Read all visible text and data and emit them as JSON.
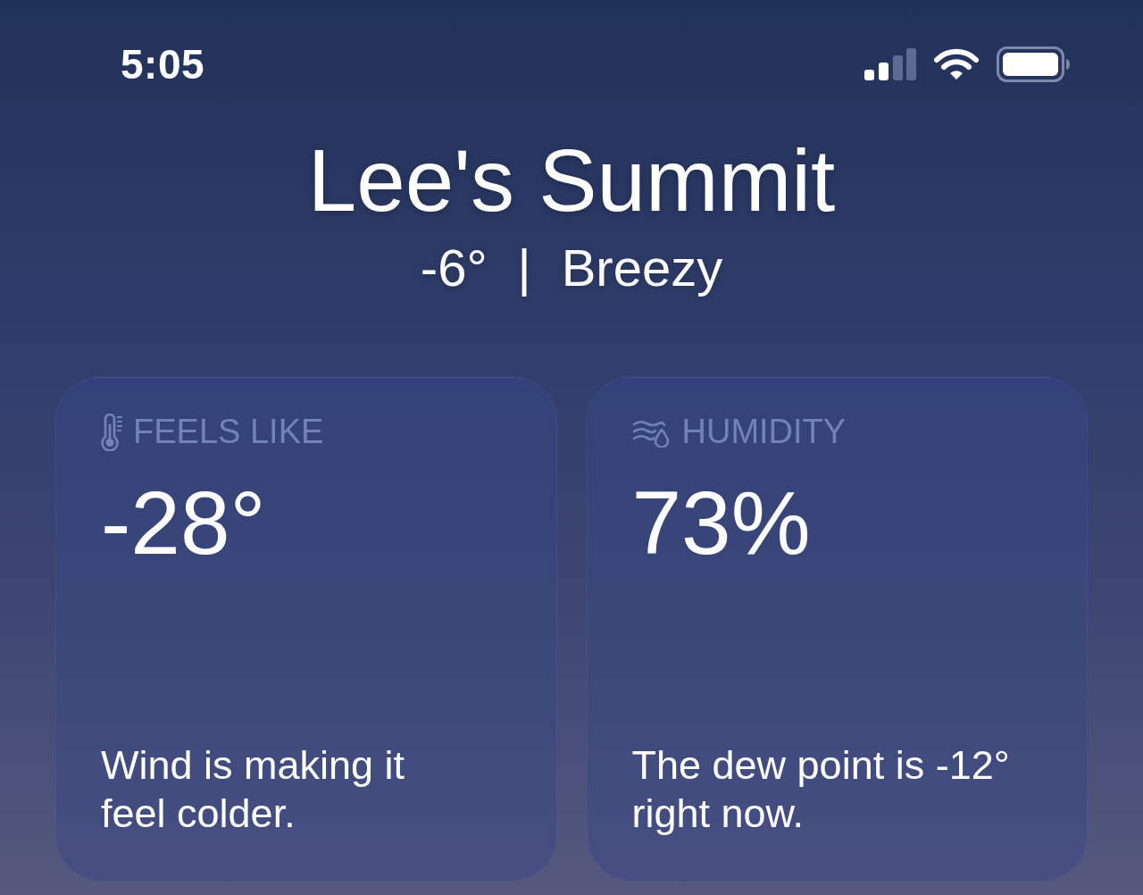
{
  "status_bar": {
    "time": "5:05"
  },
  "location": {
    "city": "Lee's Summit",
    "temperature": "-6°",
    "separator": "|",
    "condition": "Breezy"
  },
  "cards": [
    {
      "kind": "thermometer",
      "title": "FEELS LIKE",
      "value": "-28°",
      "description_lines": [
        "Wind is making it",
        "feel colder."
      ]
    },
    {
      "kind": "humidity",
      "title": "HUMIDITY",
      "value": "73%",
      "description_lines": [
        "The dew point is -12°",
        "right now."
      ]
    }
  ]
}
